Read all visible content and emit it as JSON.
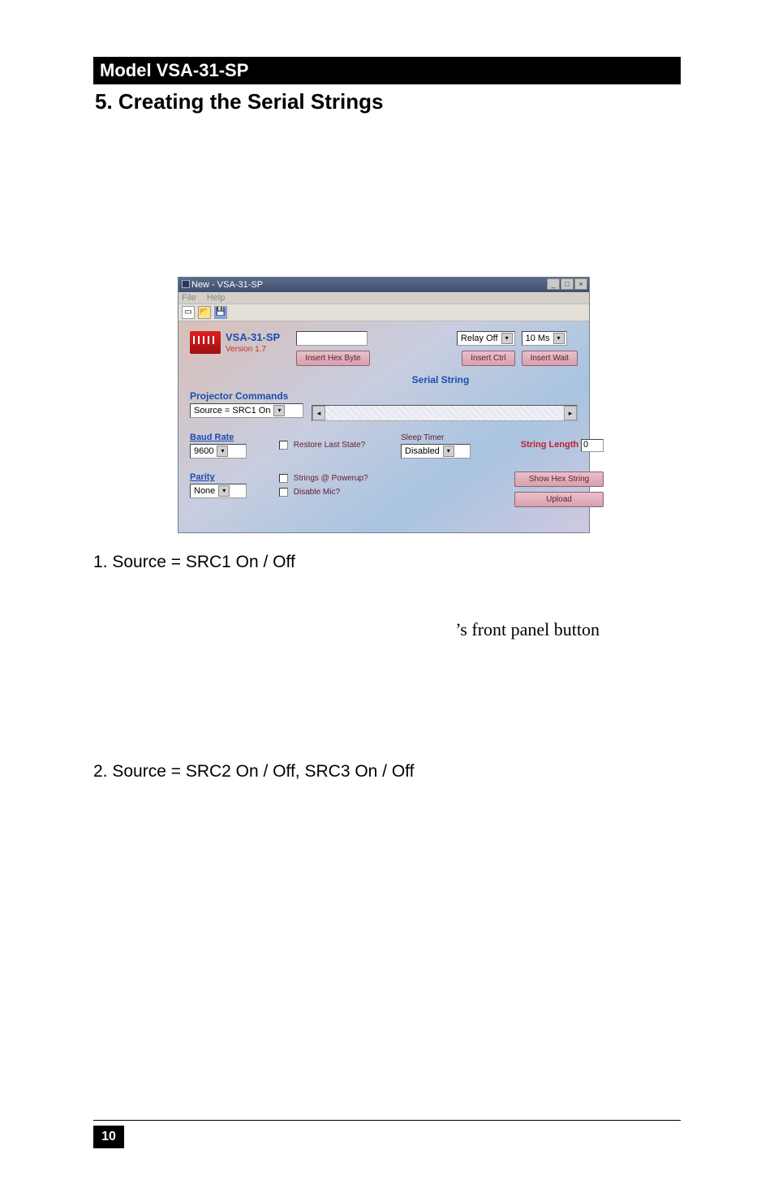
{
  "header": {
    "model": "Model VSA-31-SP"
  },
  "heading": "5.  Creating the Serial Strings",
  "window": {
    "title": "New - VSA-31-SP",
    "menu": {
      "file": "File",
      "help": "Help"
    },
    "brand": "VSA-31-SP",
    "version": "Version 1.7",
    "insert_hex_byte": "Insert Hex Byte",
    "relay_combo": "Relay Off",
    "ms_combo": "10 Ms",
    "insert_ctrl": "Insert Ctrl",
    "insert_wait": "Insert Wait",
    "serial_string_label": "Serial String",
    "projector_commands": "Projector Commands",
    "source_combo": "Source = SRC1 On",
    "baud_rate_label": "Baud Rate",
    "baud_rate_value": "9600",
    "parity_label": "Parity",
    "parity_value": "None",
    "restore_last": "Restore Last State?",
    "strings_powerup": "Strings @ Powerup?",
    "disable_mic": "Disable Mic?",
    "sleep_timer_label": "Sleep Timer",
    "sleep_timer_value": "Disabled",
    "string_length_label": "String Length",
    "string_length_value": "0",
    "show_hex_btn": "Show Hex String",
    "upload_btn": "Upload"
  },
  "body": {
    "item1": "1. Source = SRC1 On / Off",
    "serif": "’s front panel button",
    "item2": "2. Source = SRC2 On / Off, SRC3 On / Off"
  },
  "page_number": "10"
}
